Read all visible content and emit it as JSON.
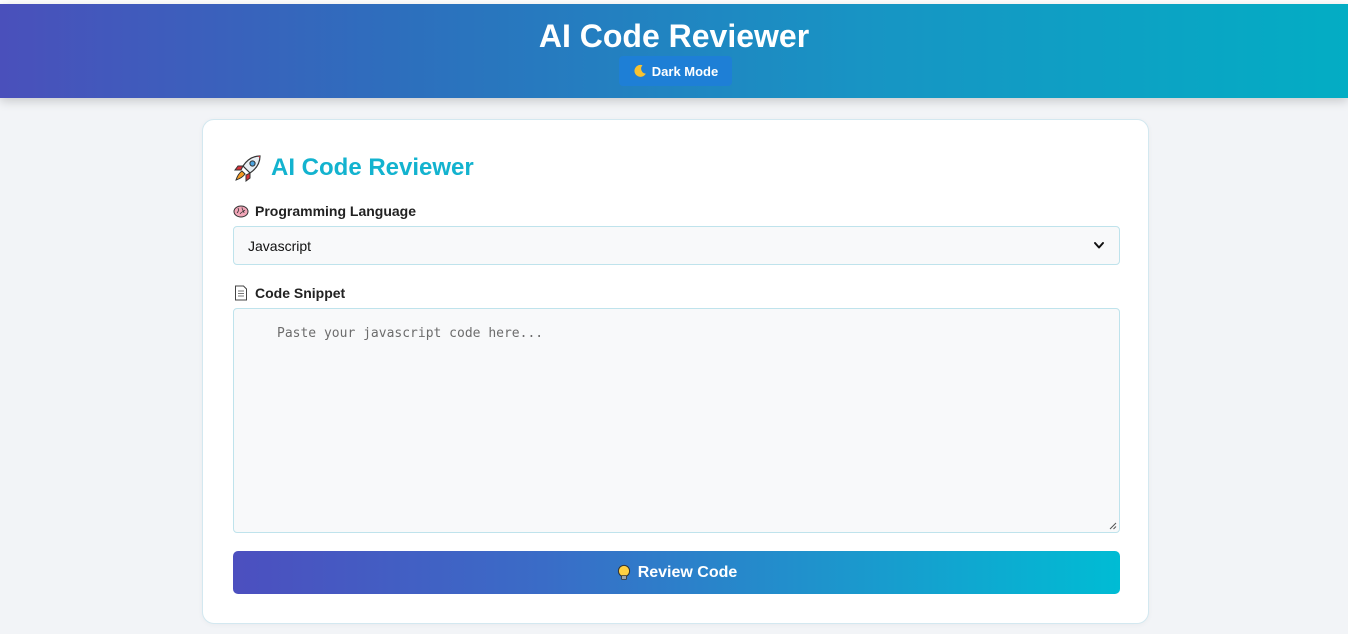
{
  "header": {
    "title": "AI Code Reviewer",
    "theme_toggle_label": "Dark Mode"
  },
  "card": {
    "title": "AI Code Reviewer",
    "language_label": "Programming Language",
    "language_selected": "Javascript",
    "code_label": "Code Snippet",
    "code_placeholder": "Paste your javascript code here...",
    "code_value": "",
    "submit_label": "Review Code"
  },
  "icons": {
    "theme_toggle": "moon-icon",
    "title": "rocket-icon",
    "language": "brain-icon",
    "code": "document-icon",
    "submit": "lightbulb-icon"
  },
  "colors": {
    "header_gradient": [
      "#4a50bb",
      "#03adc4"
    ],
    "accent": "#13b3cf",
    "toggle_button": "#1e7fd6",
    "button_gradient": [
      "#4c4fbf",
      "#00bcd4"
    ]
  }
}
